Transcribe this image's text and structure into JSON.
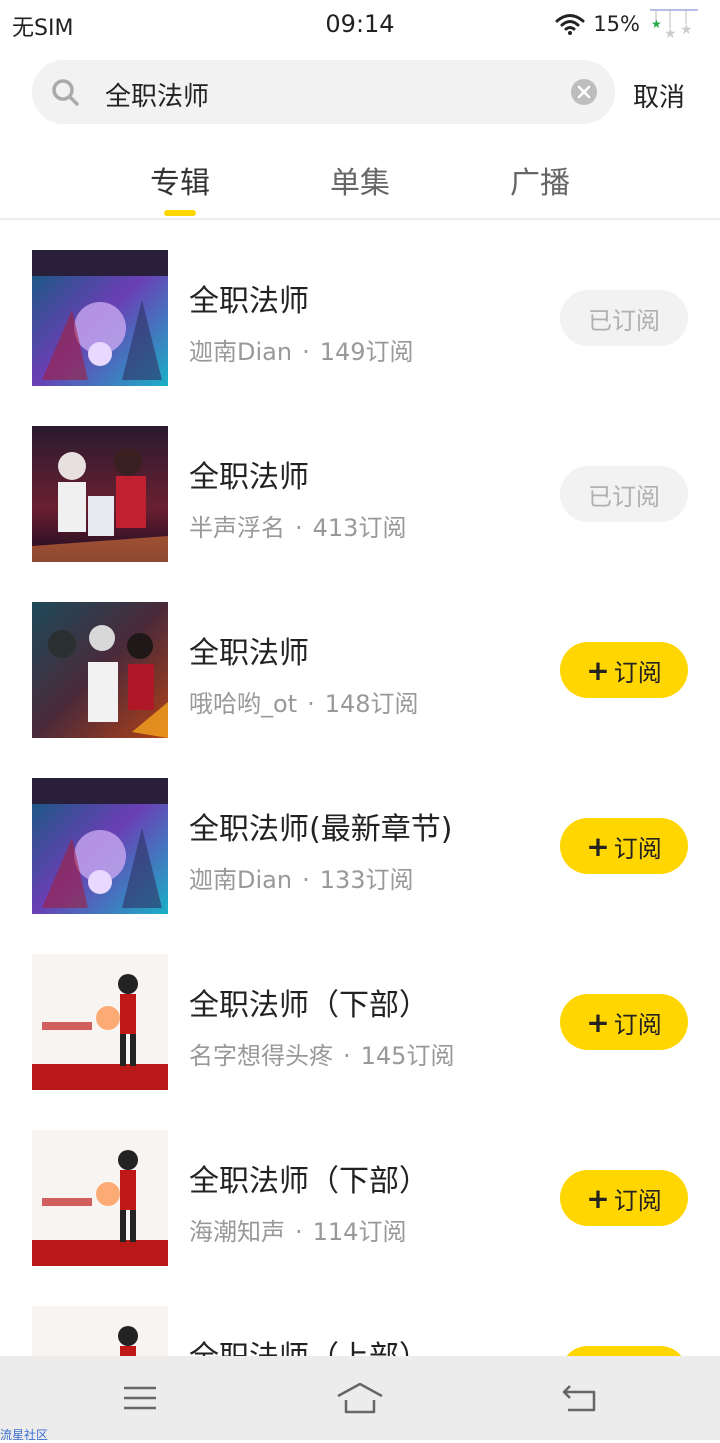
{
  "status_bar": {
    "carrier": "无SIM",
    "time": "09:14",
    "battery": "15%"
  },
  "search": {
    "query": "全职法师",
    "cancel_label": "取消"
  },
  "tabs": [
    {
      "label": "专辑",
      "active": true
    },
    {
      "label": "单集",
      "active": false
    },
    {
      "label": "广播",
      "active": false
    }
  ],
  "subscribe_label": "订阅",
  "subscribed_label": "已订阅",
  "albums": [
    {
      "title": "全职法师",
      "author": "迦南Dian",
      "subs": "149订阅",
      "subscribed": true
    },
    {
      "title": "全职法师",
      "author": "半声浮名",
      "subs": "413订阅",
      "subscribed": true
    },
    {
      "title": "全职法师",
      "author": "哦哈哟_ot",
      "subs": "148订阅",
      "subscribed": false
    },
    {
      "title": "全职法师(最新章节)",
      "author": "迦南Dian",
      "subs": "133订阅",
      "subscribed": false
    },
    {
      "title": "全职法师（下部）",
      "author": "名字想得头疼",
      "subs": "145订阅",
      "subscribed": false
    },
    {
      "title": "全职法师（下部）",
      "author": "海潮知声",
      "subs": "114订阅",
      "subscribed": false
    },
    {
      "title": "全职法师（上部）",
      "author": "",
      "subs": "",
      "subscribed": false
    }
  ],
  "watermark": "流星社区",
  "colors": {
    "accent": "#ffd600",
    "muted_text": "#999999",
    "nav_bg": "#ececec"
  }
}
